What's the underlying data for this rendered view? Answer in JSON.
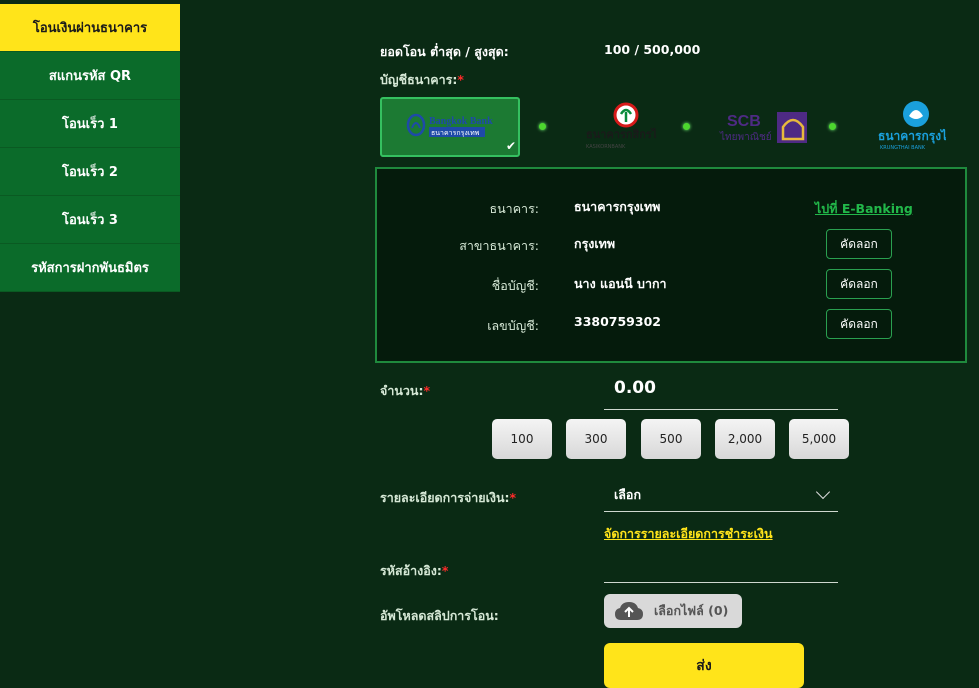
{
  "sidebar": {
    "items": [
      {
        "label": "โอนเงินผ่านธนาคาร",
        "active": true
      },
      {
        "label": "สแกนรหัส QR"
      },
      {
        "label": "โอนเร็ว 1"
      },
      {
        "label": "โอนเร็ว 2"
      },
      {
        "label": "โอนเร็ว 3"
      },
      {
        "label": "รหัสการฝากพันธมิตร"
      }
    ]
  },
  "limits": {
    "label": "ยอดโอน ต่ำสุด / สูงสุด:",
    "value": "100 / 500,000"
  },
  "bank_account": {
    "label": "บัญชีธนาคาร:",
    "required_mark": "*",
    "banks": [
      {
        "name": "Bangkok Bank",
        "sub": "ธนาคารกรุงเทพ",
        "selected": true,
        "color": "#1e4aa8"
      },
      {
        "name": "ธนาคารกสิกรไทย",
        "sub": "KASIKORNBANK",
        "color": "#0a8a3a"
      },
      {
        "name": "SCB",
        "sub": "ไทยพาณิชย์",
        "color": "#4e2a84"
      },
      {
        "name": "ธนาคารกรุงไทย",
        "sub": "KRUNGTHAI BANK",
        "color": "#1aa0dc"
      }
    ]
  },
  "account_details": {
    "ebanking_link": "ไปที่ E-Banking",
    "copy_label": "คัดลอก",
    "rows": [
      {
        "label": "ธนาคาร:",
        "value": "ธนาคารกรุงเทพ"
      },
      {
        "label": "สาขาธนาคาร:",
        "value": "กรุงเทพ"
      },
      {
        "label": "ชื่อบัญชี:",
        "value": "นาง แอนนี บากา"
      },
      {
        "label": "เลขบัญชี:",
        "value": "3380759302"
      }
    ]
  },
  "amount": {
    "label": "จำนวน:",
    "value": "0.00",
    "quick_amounts": [
      "100",
      "300",
      "500",
      "2,000",
      "5,000"
    ]
  },
  "payment_detail": {
    "label": "รายละเอียดการจ่ายเงิน:",
    "selected": "เลือก",
    "manage_link": "จัดการรายละเอียดการชำระเงิน"
  },
  "reference": {
    "label": "รหัสอ้างอิง:",
    "value": ""
  },
  "upload": {
    "label": "อัพโหลดสลิปการโอน:",
    "button": "เลือกไฟล์ (0)"
  },
  "submit": {
    "label": "ส่ง"
  },
  "colors": {
    "accent": "#ffe41a",
    "background": "#0a2a14",
    "sidebar": "#0b6b2a",
    "required": "#ff2a2a"
  }
}
